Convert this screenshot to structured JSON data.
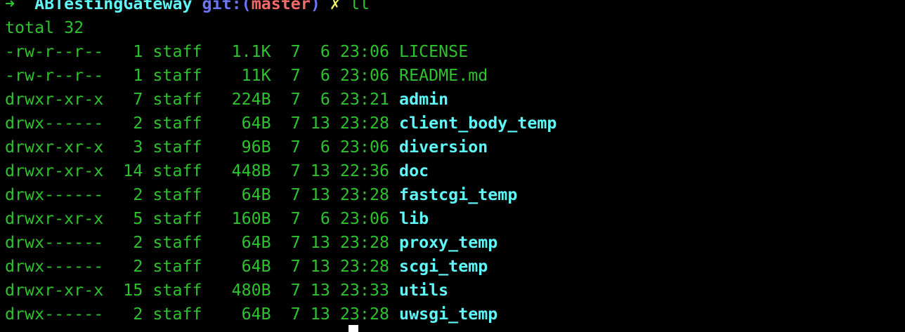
{
  "colors": {
    "green": "#2ec22e",
    "cyan": "#5ff7f7",
    "blue": "#6c74f6",
    "red": "#f16a6a",
    "yellow": "#f5f56a"
  },
  "prompt": {
    "arrow": "➜",
    "directory": "ABTestingGateway",
    "git_prefix": "git:(",
    "branch": "master",
    "git_suffix": ")",
    "dirty_mark": "✗",
    "command": "ll"
  },
  "total": "total 32",
  "rows": [
    {
      "perms": "-rw-r--r--",
      "links": "1",
      "owner": "staff",
      "size": "1.1K",
      "month": "7",
      "day": "6",
      "time": "23:06",
      "name": "LICENSE",
      "dir": false
    },
    {
      "perms": "-rw-r--r--",
      "links": "1",
      "owner": "staff",
      "size": "11K",
      "month": "7",
      "day": "6",
      "time": "23:06",
      "name": "README.md",
      "dir": false
    },
    {
      "perms": "drwxr-xr-x",
      "links": "7",
      "owner": "staff",
      "size": "224B",
      "month": "7",
      "day": "6",
      "time": "23:21",
      "name": "admin",
      "dir": true
    },
    {
      "perms": "drwx------",
      "links": "2",
      "owner": "staff",
      "size": "64B",
      "month": "7",
      "day": "13",
      "time": "23:28",
      "name": "client_body_temp",
      "dir": true
    },
    {
      "perms": "drwxr-xr-x",
      "links": "3",
      "owner": "staff",
      "size": "96B",
      "month": "7",
      "day": "6",
      "time": "23:06",
      "name": "diversion",
      "dir": true
    },
    {
      "perms": "drwxr-xr-x",
      "links": "14",
      "owner": "staff",
      "size": "448B",
      "month": "7",
      "day": "13",
      "time": "22:36",
      "name": "doc",
      "dir": true
    },
    {
      "perms": "drwx------",
      "links": "2",
      "owner": "staff",
      "size": "64B",
      "month": "7",
      "day": "13",
      "time": "23:28",
      "name": "fastcgi_temp",
      "dir": true
    },
    {
      "perms": "drwxr-xr-x",
      "links": "5",
      "owner": "staff",
      "size": "160B",
      "month": "7",
      "day": "6",
      "time": "23:06",
      "name": "lib",
      "dir": true
    },
    {
      "perms": "drwx------",
      "links": "2",
      "owner": "staff",
      "size": "64B",
      "month": "7",
      "day": "13",
      "time": "23:28",
      "name": "proxy_temp",
      "dir": true
    },
    {
      "perms": "drwx------",
      "links": "2",
      "owner": "staff",
      "size": "64B",
      "month": "7",
      "day": "13",
      "time": "23:28",
      "name": "scgi_temp",
      "dir": true
    },
    {
      "perms": "drwxr-xr-x",
      "links": "15",
      "owner": "staff",
      "size": "480B",
      "month": "7",
      "day": "13",
      "time": "23:33",
      "name": "utils",
      "dir": true
    },
    {
      "perms": "drwx------",
      "links": "2",
      "owner": "staff",
      "size": "64B",
      "month": "7",
      "day": "13",
      "time": "23:28",
      "name": "uwsgi_temp",
      "dir": true
    }
  ]
}
